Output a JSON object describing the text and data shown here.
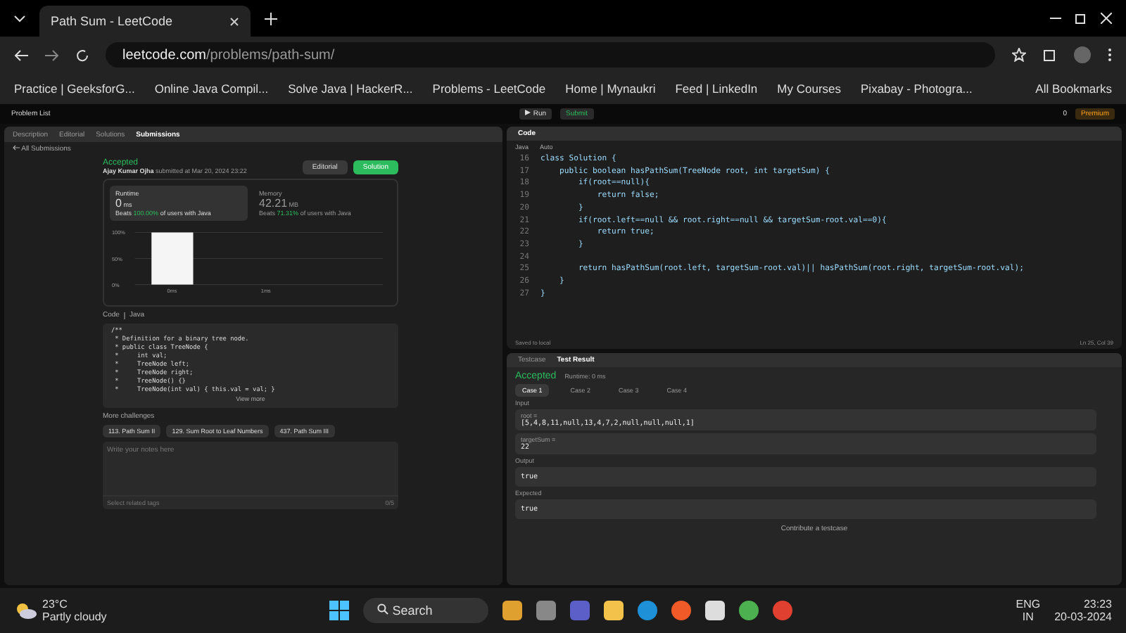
{
  "browser": {
    "tab_title": "Path Sum - LeetCode",
    "url_domain": "leetcode.com",
    "url_path": "/problems/path-sum/",
    "bookmarks": [
      "Practice | GeeksforG...",
      "Online Java Compil...",
      "Solve Java | HackerR...",
      "Problems - LeetCode",
      "Home | Mynaukri",
      "Feed | LinkedIn",
      "My Courses",
      "Pixabay - Photogra..."
    ],
    "all_bookmarks": "All Bookmarks"
  },
  "topnav": {
    "problem_list": "Problem List",
    "run": "Run",
    "submit": "Submit",
    "premium": "Premium",
    "streak": "0"
  },
  "left_tabs": [
    {
      "label": "Description",
      "selected": false
    },
    {
      "label": "Editorial",
      "selected": false
    },
    {
      "label": "Solutions",
      "selected": false
    },
    {
      "label": "Submissions",
      "selected": true
    }
  ],
  "submission": {
    "back": "All Submissions",
    "status": "Accepted",
    "author": "Ajay Kumar Ojha",
    "submitted": "submitted at Mar 20, 2024 23:22",
    "editorial": "Editorial",
    "solution": "Solution",
    "runtime": {
      "label": "Runtime",
      "value": "0",
      "unit": "ms",
      "beats": "Beats",
      "percent": "100.00%",
      "suffix": "of users with Java",
      "selected": true
    },
    "memory": {
      "label": "Memory",
      "value": "42.21",
      "unit": "MB",
      "beats": "Beats",
      "percent": "71.31%",
      "suffix": "of users with Java",
      "selected": false
    },
    "chart_data": {
      "type": "bar",
      "categories": [
        "0ms",
        "1ms"
      ],
      "values": [
        100,
        null
      ],
      "ylim": [
        0,
        100
      ],
      "yticks": [
        {
          "value": 0,
          "label": "0%"
        },
        {
          "value": 50,
          "label": "50%"
        },
        {
          "value": 100,
          "label": "100%"
        }
      ]
    },
    "code_label": "Code",
    "lang": "Java",
    "code": [
      "/**",
      " * Definition for a binary tree node.",
      " * public class TreeNode {",
      " *     int val;",
      " *     TreeNode left;",
      " *     TreeNode right;",
      " *     TreeNode() {}",
      " *     TreeNode(int val) { this.val = val; }"
    ],
    "view_more": "View more",
    "more_label": "More challenges",
    "challenges": [
      "113. Path Sum II",
      "129. Sum Root to Leaf Numbers",
      "437. Path Sum III"
    ],
    "notes_placeholder": "Write your notes here",
    "tags_placeholder": "Select related tags",
    "tags_count": "0/5"
  },
  "editor": {
    "tab": "Code",
    "lang": "Java",
    "mode": "Auto",
    "lines": [
      {
        "no": "16",
        "text": "class Solution {"
      },
      {
        "no": "17",
        "text": "    public boolean hasPathSum(TreeNode root, int targetSum) {"
      },
      {
        "no": "18",
        "text": "        if(root==null){"
      },
      {
        "no": "19",
        "text": "            return false;"
      },
      {
        "no": "20",
        "text": "        }"
      },
      {
        "no": "21",
        "text": "        if(root.left==null && root.right==null && targetSum-root.val==0){"
      },
      {
        "no": "22",
        "text": "            return true;"
      },
      {
        "no": "23",
        "text": "        }"
      },
      {
        "no": "24"
      },
      {
        "no": "25",
        "text": "        return hasPathSum(root.left, targetSum-root.val)|| hasPathSum(root.right, targetSum-root.val);"
      },
      {
        "no": "26",
        "text": "    }"
      },
      {
        "no": "27",
        "text": "}"
      }
    ],
    "saved": "Saved to local",
    "position": "Ln 25, Col 39"
  },
  "result": {
    "tabs": [
      {
        "label": "Testcase",
        "selected": false
      },
      {
        "label": "Test Result",
        "selected": true
      }
    ],
    "status": "Accepted",
    "runtime": "Runtime: 0 ms",
    "cases": [
      {
        "label": "Case 1",
        "selected": true
      },
      {
        "label": "Case 2",
        "selected": false
      },
      {
        "label": "Case 3",
        "selected": false
      },
      {
        "label": "Case 4",
        "selected": false
      }
    ],
    "input_label": "Input",
    "inputs": [
      {
        "name": "root =",
        "value": "[5,4,8,11,null,13,4,7,2,null,null,null,1]"
      },
      {
        "name": "targetSum =",
        "value": "22"
      }
    ],
    "output_label": "Output",
    "output": "true",
    "expected_label": "Expected",
    "expected": "true",
    "contribute": "Contribute a testcase"
  },
  "taskbar": {
    "temp": "23°C",
    "weather": "Partly cloudy",
    "search": "Search",
    "lang1": "ENG",
    "lang2": "IN",
    "time": "23:23",
    "date": "20-03-2024"
  }
}
